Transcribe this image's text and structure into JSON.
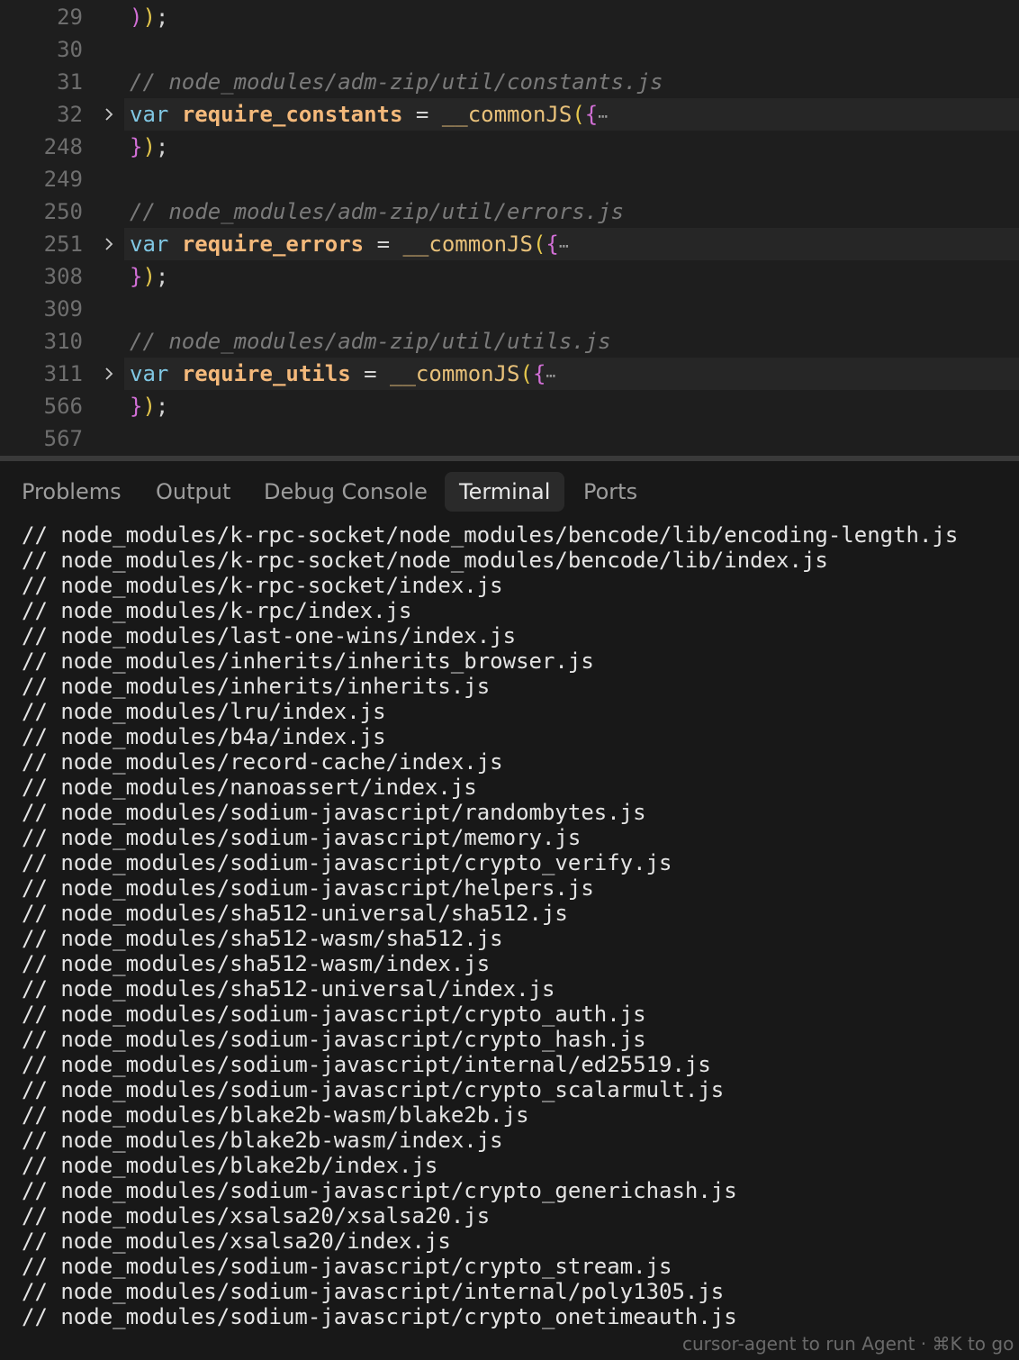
{
  "editor": {
    "lines": [
      {
        "num": "29",
        "kind": "close_paren"
      },
      {
        "num": "30",
        "kind": "blank"
      },
      {
        "num": "31",
        "kind": "comment",
        "text": "// node_modules/adm-zip/util/constants.js"
      },
      {
        "num": "32",
        "kind": "folded",
        "keyword": "var",
        "name": "require_constants",
        "op": "=",
        "fn": "__commonJS"
      },
      {
        "num": "248",
        "kind": "close_brace"
      },
      {
        "num": "249",
        "kind": "blank"
      },
      {
        "num": "250",
        "kind": "comment",
        "text": "// node_modules/adm-zip/util/errors.js"
      },
      {
        "num": "251",
        "kind": "folded",
        "keyword": "var",
        "name": "require_errors",
        "op": "=",
        "fn": "__commonJS"
      },
      {
        "num": "308",
        "kind": "close_brace"
      },
      {
        "num": "309",
        "kind": "blank"
      },
      {
        "num": "310",
        "kind": "comment",
        "text": "// node_modules/adm-zip/util/utils.js"
      },
      {
        "num": "311",
        "kind": "folded",
        "keyword": "var",
        "name": "require_utils",
        "op": "=",
        "fn": "__commonJS"
      },
      {
        "num": "566",
        "kind": "close_brace"
      },
      {
        "num": "567",
        "kind": "blank"
      }
    ]
  },
  "panel": {
    "tabs": [
      {
        "label": "Problems",
        "active": false
      },
      {
        "label": "Output",
        "active": false
      },
      {
        "label": "Debug Console",
        "active": false
      },
      {
        "label": "Terminal",
        "active": true
      },
      {
        "label": "Ports",
        "active": false
      }
    ],
    "terminal_lines": [
      "// node_modules/k-rpc-socket/node_modules/bencode/lib/encoding-length.js",
      "// node_modules/k-rpc-socket/node_modules/bencode/lib/index.js",
      "// node_modules/k-rpc-socket/index.js",
      "// node_modules/k-rpc/index.js",
      "// node_modules/last-one-wins/index.js",
      "// node_modules/inherits/inherits_browser.js",
      "// node_modules/inherits/inherits.js",
      "// node_modules/lru/index.js",
      "// node_modules/b4a/index.js",
      "// node_modules/record-cache/index.js",
      "// node_modules/nanoassert/index.js",
      "// node_modules/sodium-javascript/randombytes.js",
      "// node_modules/sodium-javascript/memory.js",
      "// node_modules/sodium-javascript/crypto_verify.js",
      "// node_modules/sodium-javascript/helpers.js",
      "// node_modules/sha512-universal/sha512.js",
      "// node_modules/sha512-wasm/sha512.js",
      "// node_modules/sha512-wasm/index.js",
      "// node_modules/sha512-universal/index.js",
      "// node_modules/sodium-javascript/crypto_auth.js",
      "// node_modules/sodium-javascript/crypto_hash.js",
      "// node_modules/sodium-javascript/internal/ed25519.js",
      "// node_modules/sodium-javascript/crypto_scalarmult.js",
      "// node_modules/blake2b-wasm/blake2b.js",
      "// node_modules/blake2b-wasm/index.js",
      "// node_modules/blake2b/index.js",
      "// node_modules/sodium-javascript/crypto_generichash.js",
      "// node_modules/xsalsa20/xsalsa20.js",
      "// node_modules/xsalsa20/index.js",
      "// node_modules/sodium-javascript/crypto_stream.js",
      "// node_modules/sodium-javascript/internal/poly1305.js",
      "// node_modules/sodium-javascript/crypto_onetimeauth.js"
    ]
  },
  "status": {
    "hint": "cursor-agent to run Agent · ⌘K to go"
  },
  "colors": {
    "editor_bg": "#1e1e1e",
    "panel_bg": "#181818",
    "comment": "#7a7a7a",
    "keyword": "#80c7e3",
    "identifier": "#f4b97b",
    "function": "#e8c17a",
    "paren": "#e6c84c",
    "brace": "#d26fd6"
  }
}
